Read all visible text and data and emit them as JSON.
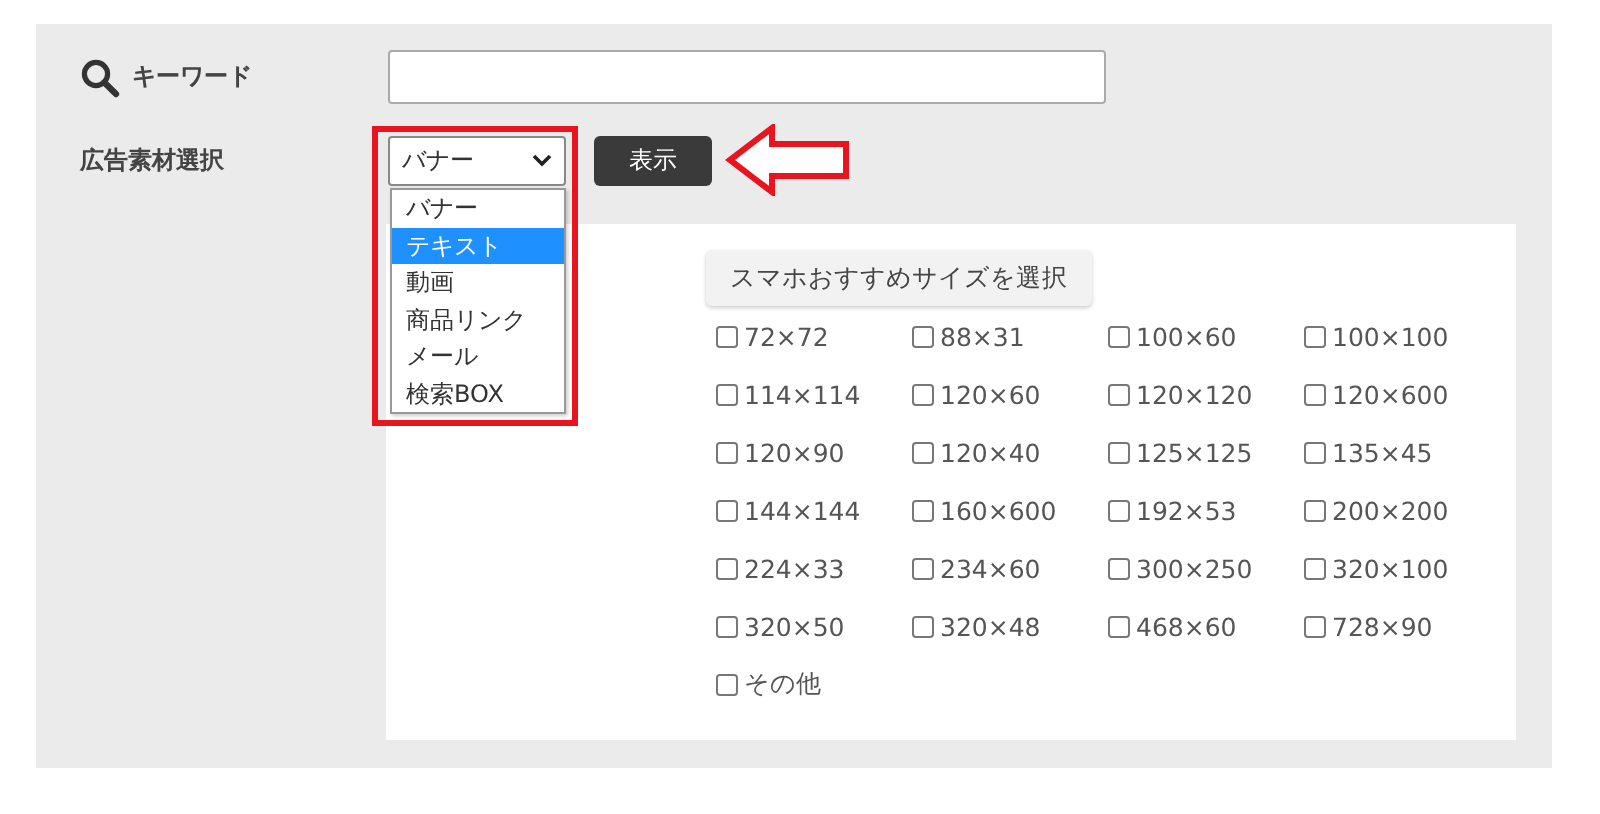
{
  "keyword": {
    "label": "キーワード"
  },
  "material_select": {
    "label": "広告素材選択",
    "value": "バナー",
    "options": [
      {
        "label": "バナー",
        "highlighted": false
      },
      {
        "label": "テキスト",
        "highlighted": true
      },
      {
        "label": "動画",
        "highlighted": false
      },
      {
        "label": "商品リンク",
        "highlighted": false
      },
      {
        "label": "メール",
        "highlighted": false
      },
      {
        "label": "検索BOX",
        "highlighted": false
      }
    ]
  },
  "show_button": "表示",
  "size_panel": {
    "preset_button": "スマホおすすめサイズを選択",
    "sizes": [
      {
        "label": "72×72",
        "checked": false
      },
      {
        "label": "88×31",
        "checked": false
      },
      {
        "label": "100×60",
        "checked": false
      },
      {
        "label": "100×100",
        "checked": false
      },
      {
        "label": "114×114",
        "checked": false
      },
      {
        "label": "120×60",
        "checked": false
      },
      {
        "label": "120×120",
        "checked": false
      },
      {
        "label": "120×600",
        "checked": false
      },
      {
        "label": "120×90",
        "checked": false
      },
      {
        "label": "120×40",
        "checked": false
      },
      {
        "label": "125×125",
        "checked": false
      },
      {
        "label": "135×45",
        "checked": false
      },
      {
        "label": "144×144",
        "checked": false
      },
      {
        "label": "160×600",
        "checked": false
      },
      {
        "label": "192×53",
        "checked": false
      },
      {
        "label": "200×200",
        "checked": false
      },
      {
        "label": "224×33",
        "checked": false
      },
      {
        "label": "234×60",
        "checked": false
      },
      {
        "label": "300×250",
        "checked": false
      },
      {
        "label": "320×100",
        "checked": false
      },
      {
        "label": "320×50",
        "checked": false
      },
      {
        "label": "320×48",
        "checked": false
      },
      {
        "label": "468×60",
        "checked": false
      },
      {
        "label": "728×90",
        "checked": false
      },
      {
        "label": "その他",
        "checked": false
      }
    ]
  }
}
